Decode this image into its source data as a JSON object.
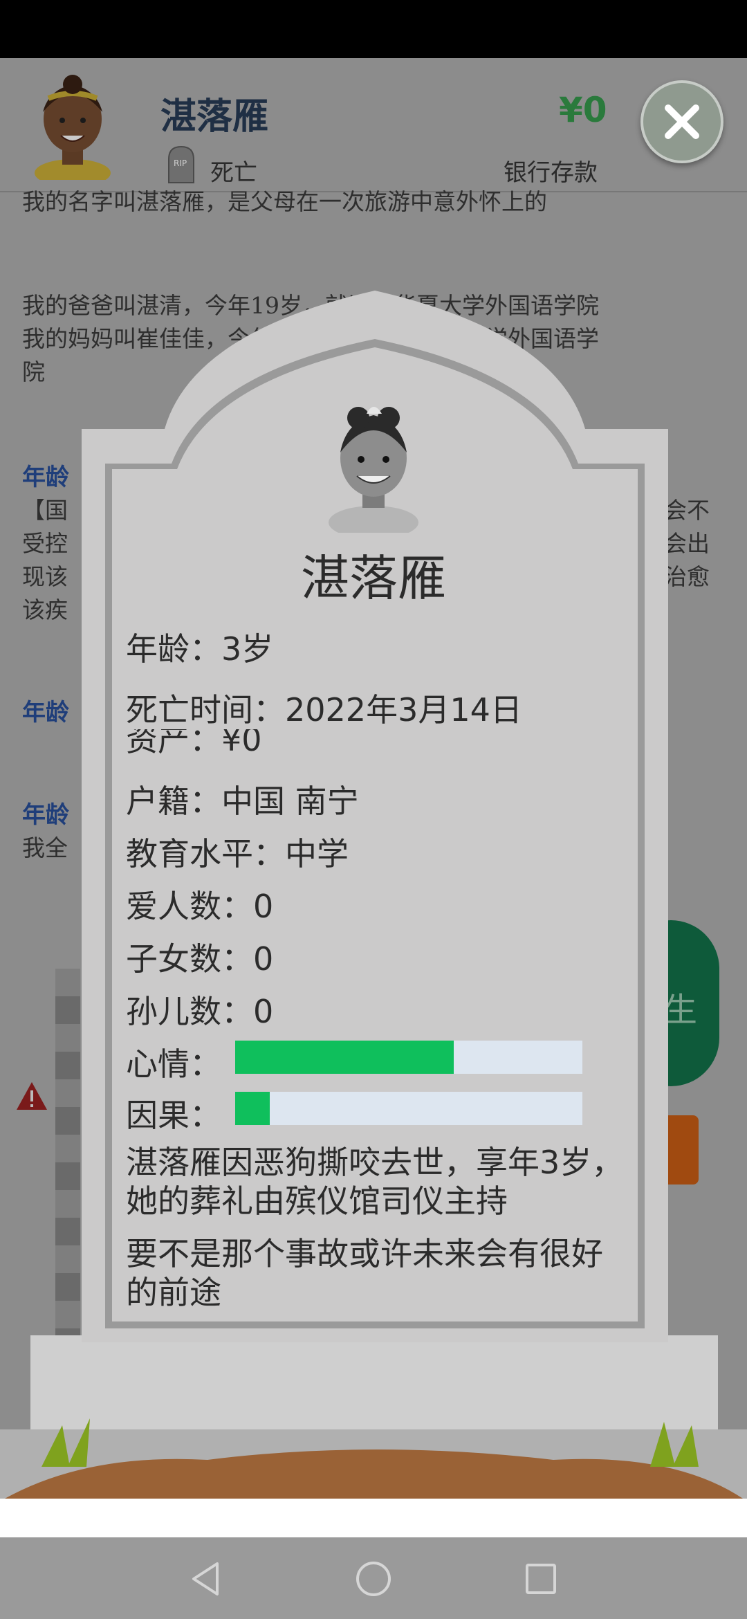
{
  "header": {
    "name": "湛落雁",
    "status": "死亡",
    "money": "¥0",
    "bank_label": "银行存款"
  },
  "background": {
    "line1": "我的名字叫湛落雁，是父母在一次旅游中意外怀上的",
    "line2": "我的爸爸叫湛清，今年19岁，就读于华夏大学外国语学院",
    "line3": "我的妈妈叫崔佳佳，今年19岁，就读于华夏大学外国语学",
    "line4": "院",
    "age_a": "年龄",
    "line5": "【国",
    "line6": "受控",
    "line7": "现该",
    "line8": "该疾",
    "age_b": "年龄",
    "age_c": "年龄",
    "line9": "我全",
    "right1": "会不",
    "right2": "会出",
    "right3": "治愈",
    "green_button": "生"
  },
  "tombstone": {
    "name": "湛落雁",
    "age_line": "年龄：3岁",
    "death_time": "死亡时间：2022年3月14日",
    "assets": "资产：¥0",
    "hometown": "户籍：中国 南宁",
    "education": "教育水平：中学",
    "lovers": "爱人数：0",
    "children": "子女数：0",
    "grandchildren": "孙儿数：0",
    "mood_label": "心情：",
    "mood_level": 0.63,
    "karma_label": "因果：",
    "karma_level": 0.1,
    "epitaph1": "湛落雁因恶狗撕咬去世，享年3岁，她的葬礼由殡仪馆司仪主持",
    "epitaph2": "要不是那个事故或许未来会有很好的前途"
  },
  "colors": {
    "mood_bar": "#0fbf5c",
    "karma_bar": "#0fbf5c",
    "bar_track": "#dde6f0",
    "money": "#2a7a3c"
  }
}
